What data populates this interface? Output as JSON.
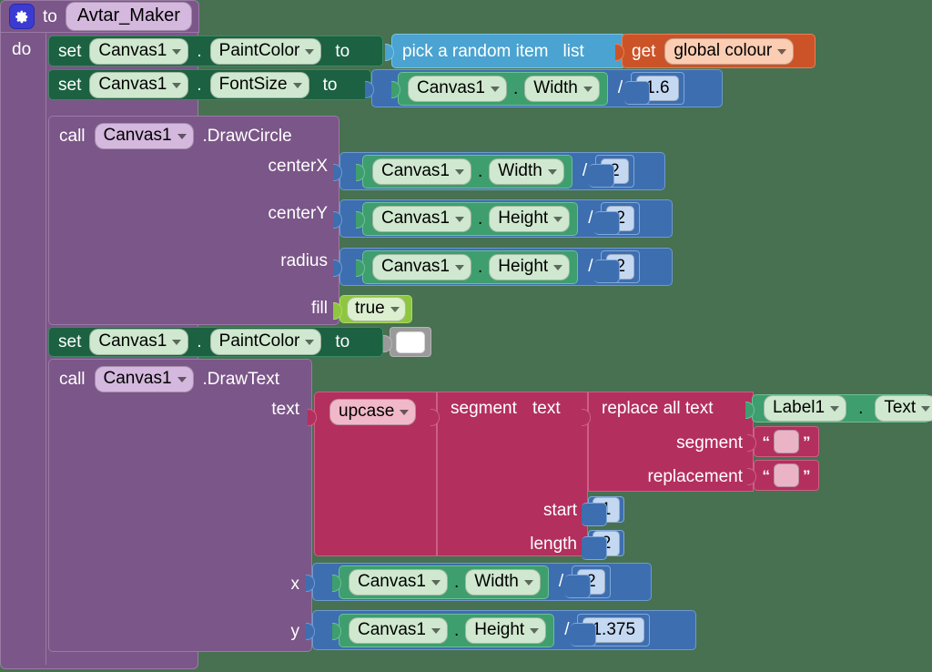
{
  "workspace": {
    "background_color": "#477150"
  },
  "procedure": {
    "gear_icon": "gear-icon",
    "to_label": "to",
    "name": "Avtar_Maker",
    "do_label": "do"
  },
  "statements": {
    "set_paintcolor_random": {
      "set_label": "set",
      "component": "Canvas1",
      "property": "PaintColor",
      "to_label": "to",
      "value": {
        "list_label": "pick a random item",
        "list_arg_label": "list",
        "get_label": "get",
        "variable": "global colour"
      }
    },
    "set_fontsize": {
      "set_label": "set",
      "component": "Canvas1",
      "property": "FontSize",
      "to_label": "to",
      "value": {
        "left_component": "Canvas1",
        "left_property": "Width",
        "operator": "/",
        "right_number": "1.6"
      }
    },
    "call_drawcircle": {
      "call_label": "call",
      "component": "Canvas1",
      "method": ".DrawCircle",
      "args": [
        {
          "label": "centerX",
          "left_component": "Canvas1",
          "left_property": "Width",
          "operator": "/",
          "right_number": "2"
        },
        {
          "label": "centerY",
          "left_component": "Canvas1",
          "left_property": "Height",
          "operator": "/",
          "right_number": "2"
        },
        {
          "label": "radius",
          "left_component": "Canvas1",
          "left_property": "Height",
          "operator": "/",
          "right_number": "2"
        }
      ],
      "fill_label": "fill",
      "fill_value": "true"
    },
    "set_paintcolor_white": {
      "set_label": "set",
      "component": "Canvas1",
      "property": "PaintColor",
      "to_label": "to",
      "color_value": "#ffffff"
    },
    "call_drawtext": {
      "call_label": "call",
      "component": "Canvas1",
      "method": ".DrawText",
      "text_label": "text",
      "upcase_label": "upcase",
      "segment_label": "segment",
      "segment_text_label": "text",
      "replace_all_text_label": "replace all text",
      "replace_source_component": "Label1",
      "replace_source_property": "Text",
      "replace_segment_label": "segment",
      "replace_segment_value": "",
      "replace_replacement_label": "replacement",
      "replace_replacement_value": "",
      "start_label": "start",
      "start_value": "1",
      "length_label": "length",
      "length_value": "2",
      "x_label": "x",
      "x_left_component": "Canvas1",
      "x_left_property": "Width",
      "x_operator": "/",
      "x_right_number": "2",
      "y_label": "y",
      "y_left_component": "Canvas1",
      "y_left_property": "Height",
      "y_operator": "/",
      "y_right_number": "1.375"
    }
  },
  "colors": {
    "procedure_purple": "#7b5688",
    "setter_green": "#1c6141",
    "getter_green": "#3e9e6e",
    "math_blue": "#3d6eb0",
    "list_blue": "#4aa3d0",
    "variable_orange": "#cc5327",
    "logic_green": "#8fc640",
    "text_crimson": "#b32f5e",
    "color_gray": "#9a9a9a"
  }
}
